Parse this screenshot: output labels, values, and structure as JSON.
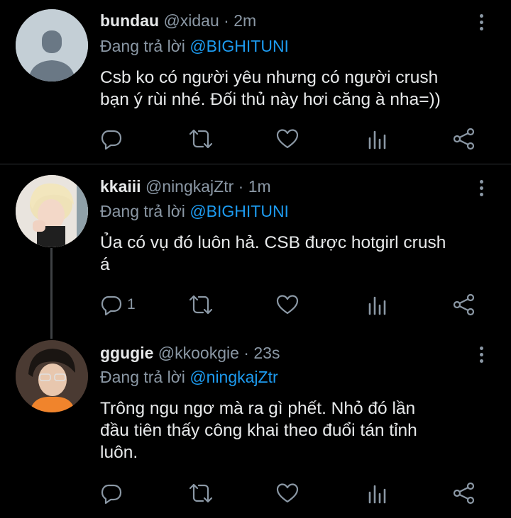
{
  "tweets": [
    {
      "name": "bundau",
      "handle": "@xidau",
      "separator": "·",
      "time": "2m",
      "reply_prefix": "Đang trả lời",
      "reply_to": "@BIGHITUNI",
      "text_lines": [
        "Csb ko có người yêu nhưng có người crush",
        "bạn ý rùi nhé. Đối thủ này hơi căng à nha=))"
      ],
      "reply_count": ""
    },
    {
      "name": "kkaiii",
      "handle": "@ningkajZtr",
      "separator": "·",
      "time": "1m",
      "reply_prefix": "Đang trả lời",
      "reply_to": "@BIGHITUNI",
      "text_lines": [
        "Ủa có vụ đó luôn hả. CSB được hotgirl crush",
        "á"
      ],
      "reply_count": "1"
    },
    {
      "name": "ggugie",
      "handle": "@kkookgie",
      "separator": "·",
      "time": "23s",
      "reply_prefix": "Đang trả lời",
      "reply_to": "@ningkajZtr",
      "text_lines": [
        "Trông ngu ngơ mà ra gì phết. Nhỏ đó lần",
        "đầu tiên thấy công khai theo đuổi tán tỉnh",
        "luôn."
      ],
      "reply_count": ""
    }
  ],
  "icons": {
    "reply": "reply-icon",
    "retweet": "retweet-icon",
    "like": "heart-icon",
    "analytics": "analytics-icon",
    "share": "share-icon",
    "more": "more-vertical-icon"
  },
  "colors": {
    "background": "#000000",
    "mention": "#1d9bf0",
    "secondary_text": "#8b98a5",
    "primary_text": "#e7e9ea"
  }
}
